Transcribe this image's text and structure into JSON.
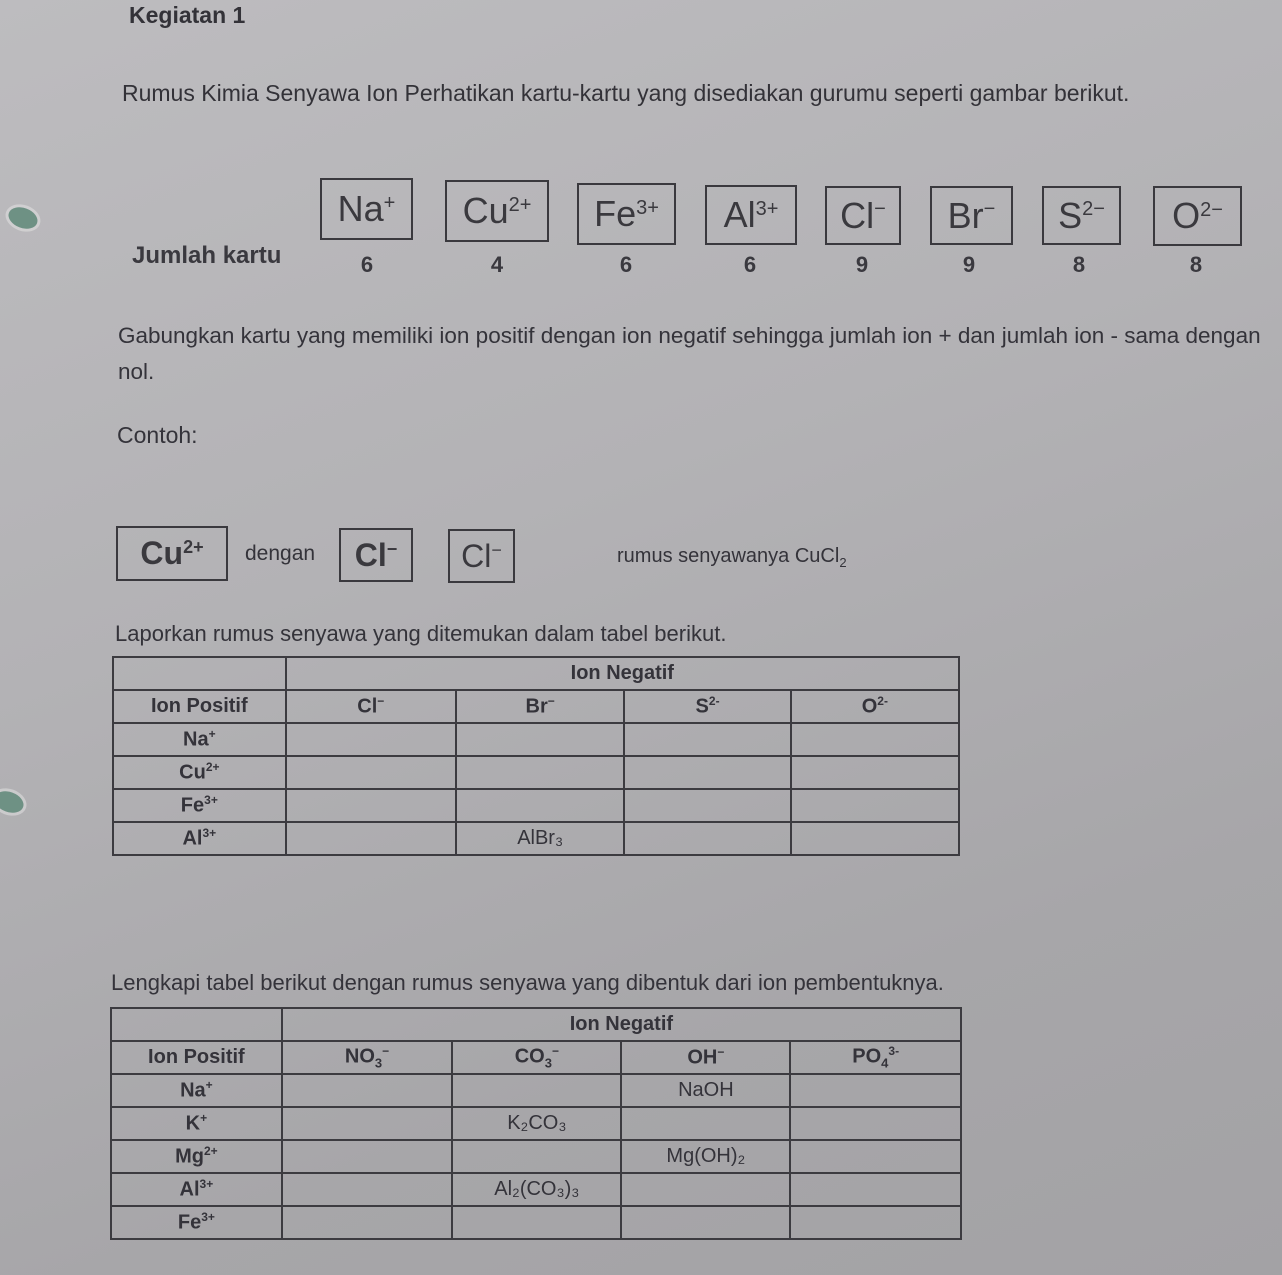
{
  "title": "Kegiatan 1",
  "intro": "Rumus Kimia Senyawa Ion Perhatikan kartu-kartu yang disediakan gurumu seperti gambar berikut.",
  "cards": {
    "label": "Jumlah kartu",
    "items": [
      {
        "symbol": "Na",
        "charge": "+",
        "count": "6"
      },
      {
        "symbol": "Cu",
        "charge": "2+",
        "count": "4"
      },
      {
        "symbol": "Fe",
        "charge": "3+",
        "count": "6"
      },
      {
        "symbol": "Al",
        "charge": "3+",
        "count": "6"
      },
      {
        "symbol": "Cl",
        "charge": "−",
        "count": "9"
      },
      {
        "symbol": "Br",
        "charge": "−",
        "count": "9"
      },
      {
        "symbol": "S",
        "charge": "2−",
        "count": "8"
      },
      {
        "symbol": "O",
        "charge": "2−",
        "count": "8"
      }
    ]
  },
  "instruction": "Gabungkan kartu yang memiliki ion positif dengan ion negatif sehingga jumlah ion + dan jumlah ion - sama dengan nol.",
  "example": {
    "label": "Contoh:",
    "card1": {
      "symbol": "Cu",
      "charge": "2+"
    },
    "connector": "dengan",
    "card2": {
      "symbol": "Cl",
      "charge": "−"
    },
    "card3": {
      "symbol": "Cl",
      "charge": "−"
    },
    "result_prefix": "rumus senyawanya CuCl",
    "result_sub": "2"
  },
  "table1": {
    "heading": "Laporkan rumus senyawa yang ditemukan dalam tabel berikut.",
    "group_header": "Ion Negatif",
    "row_header": "Ion Positif",
    "columns": [
      {
        "symbol": "Cl",
        "charge": "−"
      },
      {
        "symbol": "Br",
        "charge": "−"
      },
      {
        "symbol": "S",
        "charge": "2-"
      },
      {
        "symbol": "O",
        "charge": "2-"
      }
    ],
    "rows": [
      {
        "symbol": "Na",
        "charge": "+",
        "cells": [
          "",
          "",
          "",
          ""
        ]
      },
      {
        "symbol": "Cu",
        "charge": "2+",
        "cells": [
          "",
          "",
          "",
          ""
        ]
      },
      {
        "symbol": "Fe",
        "charge": "3+",
        "cells": [
          "",
          "",
          "",
          ""
        ]
      },
      {
        "symbol": "Al",
        "charge": "3+",
        "cells": [
          "",
          "AlBr₃",
          "",
          ""
        ]
      }
    ]
  },
  "table2": {
    "heading": "Lengkapi tabel berikut dengan rumus senyawa yang dibentuk dari ion pembentuknya.",
    "group_header": "Ion Negatif",
    "row_header": "Ion Positif",
    "columns": [
      {
        "symbol": "NO",
        "sub": "3",
        "charge": "−"
      },
      {
        "symbol": "CO",
        "sub": "3",
        "charge": "−"
      },
      {
        "symbol": "OH",
        "sub": "",
        "charge": "−"
      },
      {
        "symbol": "PO",
        "sub": "4",
        "charge": "3-"
      }
    ],
    "rows": [
      {
        "symbol": "Na",
        "charge": "+",
        "cells": [
          "",
          "",
          "NaOH",
          ""
        ]
      },
      {
        "symbol": "K",
        "charge": "+",
        "cells": [
          "",
          "K₂CO₃",
          "",
          ""
        ]
      },
      {
        "symbol": "Mg",
        "charge": "2+",
        "cells": [
          "",
          "",
          "Mg(OH)₂",
          ""
        ]
      },
      {
        "symbol": "Al",
        "charge": "3+",
        "cells": [
          "",
          "Al₂(CO₃)₃",
          "",
          ""
        ]
      },
      {
        "symbol": "Fe",
        "charge": "3+",
        "cells": [
          "",
          "",
          "",
          ""
        ]
      }
    ]
  },
  "colors": {
    "paper": "#b3b2b5",
    "ink": "#34333a",
    "binder_clip": "#6e9184"
  }
}
